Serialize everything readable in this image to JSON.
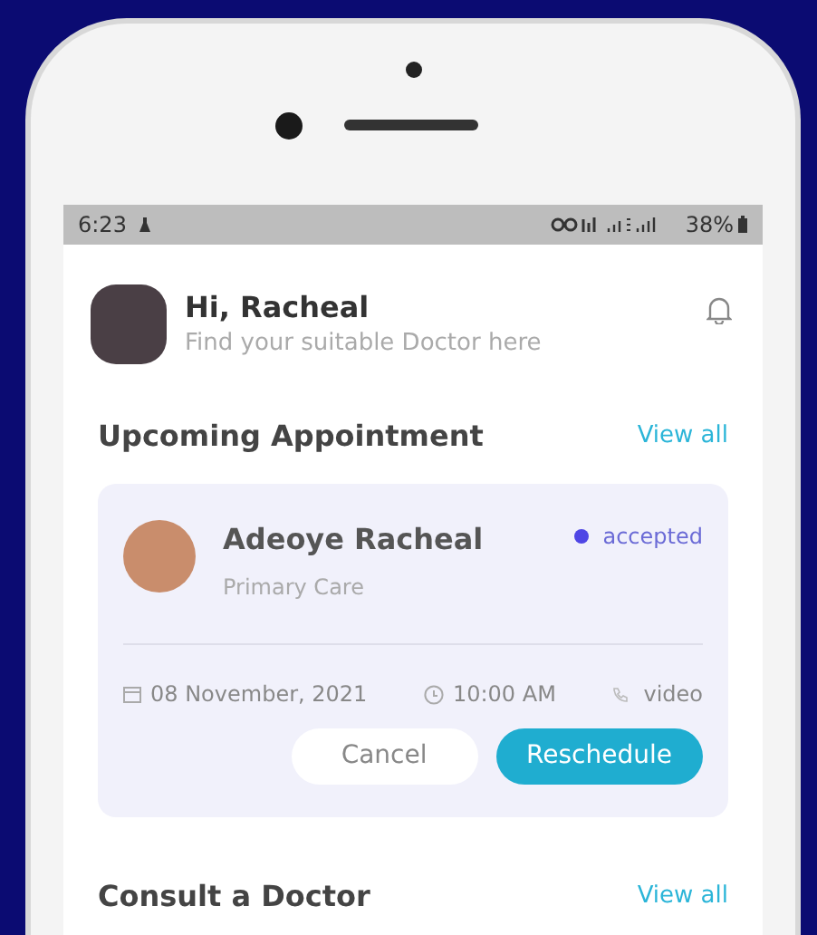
{
  "status_bar": {
    "time": "6:23",
    "battery": "38%"
  },
  "header": {
    "greeting": "Hi, Racheal",
    "subtitle": "Find your suitable Doctor here"
  },
  "upcoming": {
    "title": "Upcoming Appointment",
    "link": "View all",
    "appointment": {
      "name": "Adeoye Racheal",
      "specialty": "Primary Care",
      "status": "accepted",
      "color": "#4f46e5",
      "date": "08 November, 2021",
      "time": "10:00 AM",
      "type": "video"
    },
    "buttons": [
      {
        "label": "Cancel",
        "kind": "secondary"
      },
      {
        "label": "Reschedule",
        "kind": "primary"
      }
    ]
  },
  "consult": {
    "title": "Consult a Doctor",
    "link": "View all"
  }
}
